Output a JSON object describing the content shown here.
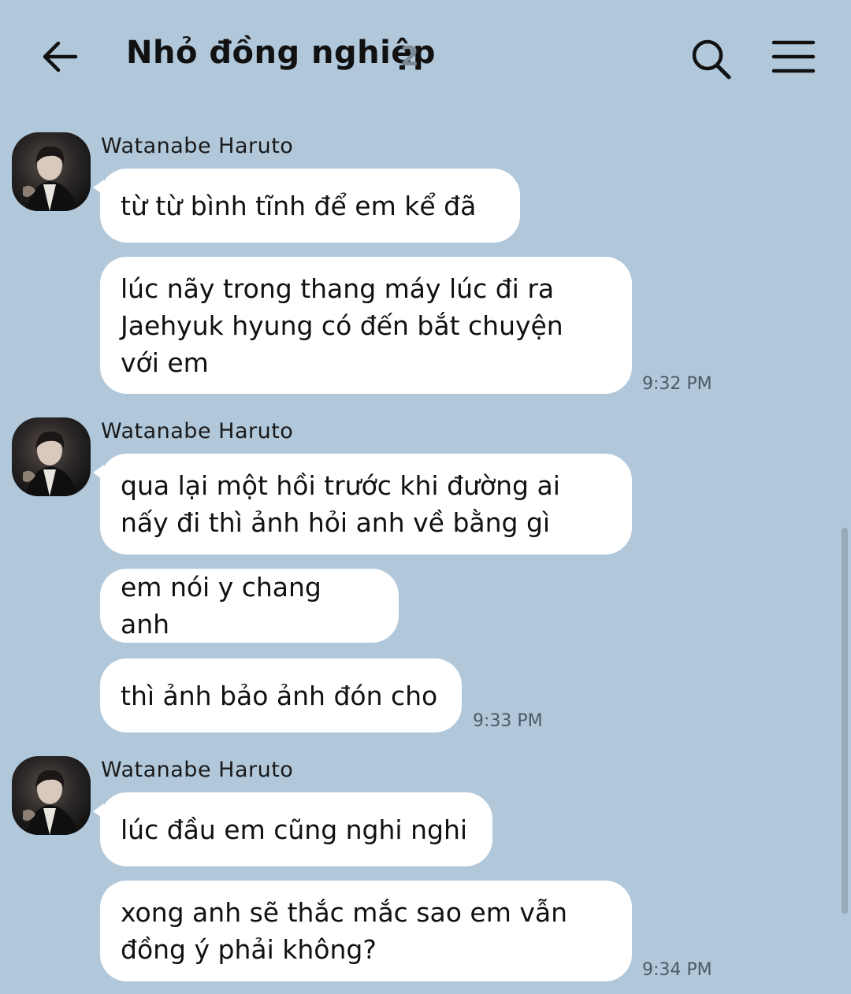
{
  "header": {
    "title": "Nhỏ đồng nghiệp",
    "member_count": "2",
    "back_icon": "arrow-left-icon",
    "search_icon": "search-icon",
    "menu_icon": "menu-icon"
  },
  "colors": {
    "background": "#b1c7da",
    "bubble": "#ffffff",
    "time": "#4d5a66",
    "count": "#7c8a96"
  },
  "groups": [
    {
      "sender": "Watanabe Haruto",
      "messages": [
        "từ từ bình tĩnh để em kể đã",
        "lúc nãy trong thang máy lúc đi ra\nJaehyuk hyung có đến bắt chuyện\nvới em"
      ],
      "time": "9:32 PM"
    },
    {
      "sender": "Watanabe Haruto",
      "messages": [
        "qua lại một hồi trước khi đường ai\nnấy đi thì ảnh hỏi anh về bằng gì",
        "em nói y chang anh",
        "thì ảnh bảo ảnh đón cho"
      ],
      "time": "9:33 PM"
    },
    {
      "sender": "Watanabe Haruto",
      "messages": [
        "lúc đầu em cũng nghi nghi",
        "xong anh sẽ thắc mắc sao em vẫn\nđồng ý phải không?"
      ],
      "time": "9:34 PM"
    }
  ]
}
